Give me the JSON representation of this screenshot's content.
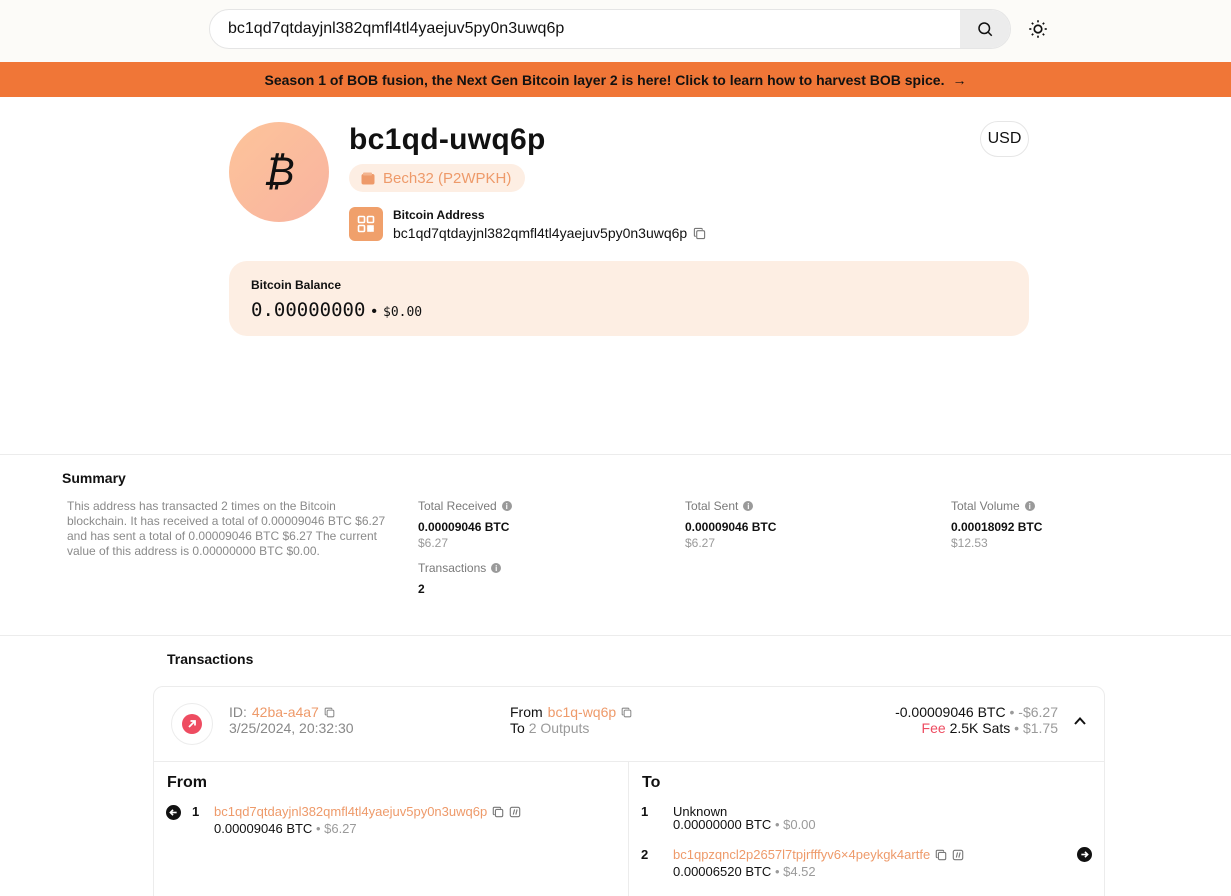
{
  "search": {
    "value": "bc1qd7qtdayjnl382qmfl4tl4yaejuv5py0n3uwq6p"
  },
  "banner": {
    "text": "Season 1 of BOB fusion, the Next Gen Bitcoin layer 2 is here! Click to learn how to harvest BOB spice.",
    "arrow": "→"
  },
  "header": {
    "avatar_glyph": "₿",
    "short_address": "bc1qd-uwq6p",
    "address_type": "Bech32 (P2WPKH)",
    "address_label": "Bitcoin Address",
    "full_address": "bc1qd7qtdayjnl382qmfl4tl4yaejuv5py0n3uwq6p",
    "currency": "USD"
  },
  "balance": {
    "label": "Bitcoin Balance",
    "btc": "0.00000000",
    "separator": "•",
    "usd": "$0.00"
  },
  "summary": {
    "title": "Summary",
    "description": "This address has transacted 2 times on the Bitcoin blockchain. It has received a total of 0.00009046 BTC $6.27 and has sent a total of 0.00009046 BTC $6.27 The current value of this address is 0.00000000 BTC $0.00.",
    "total_received": {
      "label": "Total Received",
      "btc": "0.00009046 BTC",
      "usd": "$6.27"
    },
    "total_sent": {
      "label": "Total Sent",
      "btc": "0.00009046 BTC",
      "usd": "$6.27"
    },
    "total_volume": {
      "label": "Total Volume",
      "btc": "0.00018092 BTC",
      "usd": "$12.53"
    },
    "transactions": {
      "label": "Transactions",
      "value": "2"
    }
  },
  "transactions": {
    "title": "Transactions",
    "items": [
      {
        "id_label": "ID:",
        "id": "42ba-a4a7",
        "date": "3/25/2024, 20:32:30",
        "from_label": "From",
        "from": "bc1q-wq6p",
        "to_label": "To",
        "to": "2 Outputs",
        "amount": "-0.00009046 BTC",
        "amount_usd": "-$6.27",
        "fee_label": "Fee",
        "fee": "2.5K Sats",
        "fee_usd": "$1.75",
        "inputs_title": "From",
        "outputs_title": "To",
        "inputs": [
          {
            "index": "1",
            "address": "bc1qd7qtdayjnl382qmfl4tl4yaejuv5py0n3uwq6p",
            "btc": "0.00009046",
            "unit": "BTC",
            "usd": "$6.27"
          }
        ],
        "outputs": [
          {
            "index": "1",
            "address": "Unknown",
            "btc": "0.00000000",
            "unit": "BTC",
            "usd": "$0.00"
          },
          {
            "index": "2",
            "address": "bc1qpzqncl2p2657l7tpjrfffyv6×4peykgk4artfe",
            "btc": "0.00006520",
            "unit": "BTC",
            "usd": "$4.52"
          }
        ]
      }
    ]
  },
  "colors": {
    "accent": "#f07637",
    "soft_accent": "#fdeee3",
    "link": "#ee9a6a",
    "negative": "#ee4c61"
  },
  "icons": [
    "search-icon",
    "sun-icon",
    "arrow-right-icon",
    "bitcoin-icon",
    "wallet-icon",
    "qr-code-icon",
    "copy-icon",
    "info-icon",
    "arrow-up-right-icon",
    "chevron-up-icon",
    "arrow-left-circle-icon",
    "explorer-icon",
    "arrow-right-circle-icon"
  ]
}
